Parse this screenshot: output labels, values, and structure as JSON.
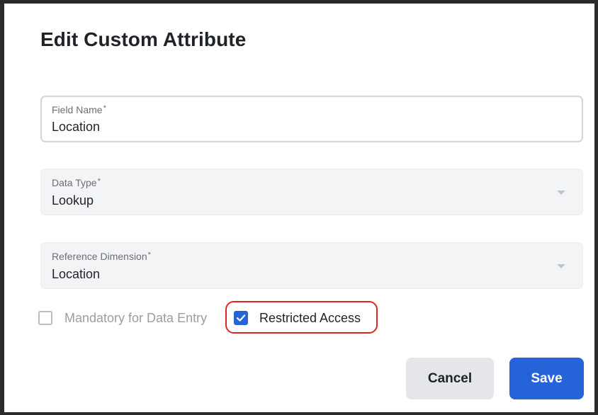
{
  "dialog": {
    "title": "Edit Custom Attribute"
  },
  "fields": {
    "field_name": {
      "label": "Field Name",
      "required_mark": "*",
      "value": "Location"
    },
    "data_type": {
      "label": "Data Type",
      "required_mark": "*",
      "value": "Lookup"
    },
    "reference_dimension": {
      "label": "Reference Dimension",
      "required_mark": "*",
      "value": "Location"
    }
  },
  "checkboxes": {
    "mandatory": {
      "label": "Mandatory for Data Entry",
      "checked": false,
      "disabled": true
    },
    "restricted": {
      "label": "Restricted Access",
      "checked": true
    }
  },
  "actions": {
    "cancel_label": "Cancel",
    "save_label": "Save"
  },
  "icons": {
    "dropdown": "chevron-down-icon",
    "check": "check-icon"
  },
  "colors": {
    "primary": "#2563d9",
    "highlight": "#e02424",
    "disabled_bg": "#f3f4f5"
  }
}
